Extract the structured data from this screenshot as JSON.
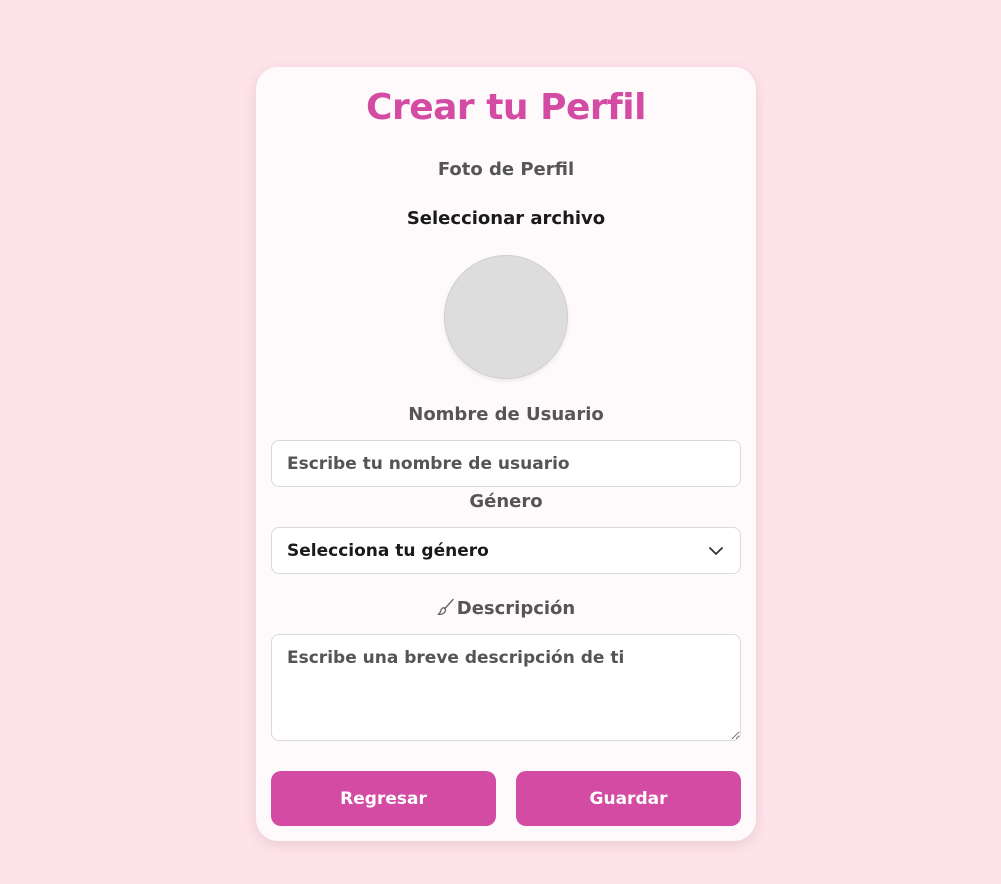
{
  "form": {
    "title": "Crear tu Perfil",
    "photo_label": "Foto de Perfil",
    "file_button": "Seleccionar archivo",
    "username_label": "Nombre de Usuario",
    "username_placeholder": "Escribe tu nombre de usuario",
    "username_value": "",
    "gender_label": "Género",
    "gender_selected": "Selecciona tu género",
    "description_label": "Descripción",
    "description_placeholder": "Escribe una breve descripción de ti",
    "back_button": "Regresar",
    "save_button": "Guardar"
  },
  "icons": {
    "description": "paintbrush-icon",
    "select": "chevron-down-icon"
  },
  "colors": {
    "background": "#ffe3ea",
    "card": "#fefafb",
    "accent": "#d34ba3",
    "label_text": "#555555",
    "avatar_placeholder": "#dddddd"
  }
}
